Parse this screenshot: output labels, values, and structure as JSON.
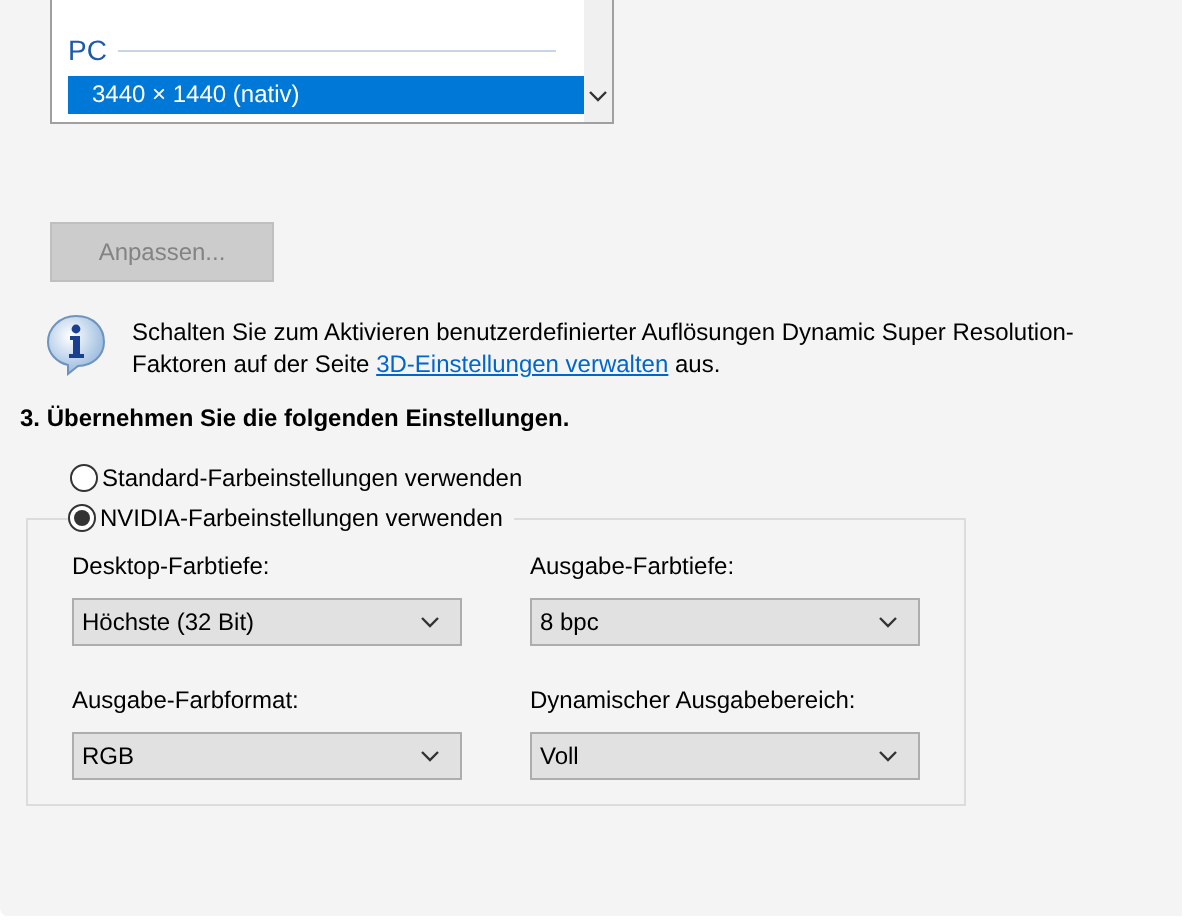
{
  "resolution_list": {
    "group": "PC",
    "items": [
      {
        "label": "3440 × 1440 (nativ)",
        "selected": true
      }
    ]
  },
  "customize_button": {
    "label": "Anpassen...",
    "disabled": true
  },
  "info": {
    "text_before": "Schalten Sie zum Aktivieren benutzerdefinierter Auflösungen Dynamic Super Resolution-Faktoren auf der Seite ",
    "link": "3D-Einstellungen verwalten",
    "text_after": " aus."
  },
  "step_heading": "3. Übernehmen Sie die folgenden Einstellungen.",
  "color_options": [
    {
      "label": "Standard-Farbeinstellungen verwenden",
      "selected": false
    },
    {
      "label": "NVIDIA-Farbeinstellungen verwenden",
      "selected": true
    }
  ],
  "settings": [
    {
      "label": "Desktop-Farbtiefe:",
      "value": "Höchste (32 Bit)"
    },
    {
      "label": "Ausgabe-Farbtiefe:",
      "value": "8 bpc"
    },
    {
      "label": "Ausgabe-Farbformat:",
      "value": "RGB"
    },
    {
      "label": "Dynamischer Ausgabebereich:",
      "value": "Voll"
    }
  ]
}
